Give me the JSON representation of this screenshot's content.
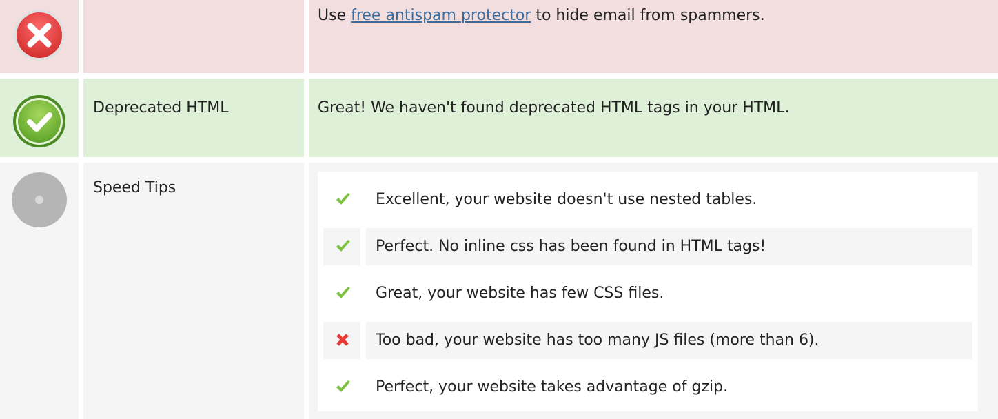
{
  "rows": {
    "email": {
      "status": "error",
      "label": "",
      "message_prefix": "Use ",
      "message_link": "free antispam protector",
      "message_suffix": " to hide email from spammers."
    },
    "deprecated": {
      "status": "ok",
      "label": "Deprecated HTML",
      "message": "Great! We haven't found deprecated HTML tags in your HTML."
    },
    "speed": {
      "status": "info",
      "label": "Speed Tips",
      "tips": [
        {
          "status": "ok",
          "text": "Excellent, your website doesn't use nested tables."
        },
        {
          "status": "ok",
          "text": "Perfect. No inline css has been found in HTML tags!"
        },
        {
          "status": "ok",
          "text": "Great, your website has few CSS files."
        },
        {
          "status": "error",
          "text": "Too bad, your website has too many JS files (more than 6)."
        },
        {
          "status": "ok",
          "text": "Perfect, your website takes advantage of gzip."
        }
      ]
    }
  },
  "colors": {
    "error_bg": "#f2dede",
    "ok_bg": "#dff0d8",
    "info_bg": "#f5f5f5",
    "error_icon": "#e53935",
    "ok_icon": "#7cc242",
    "info_icon": "#b5b5b5",
    "link": "#3b6da0"
  },
  "icons": {
    "error": "x-circle-icon",
    "ok": "check-circle-icon",
    "info": "grey-circle-icon",
    "tip_ok": "checkmark-icon",
    "tip_error": "cross-icon"
  }
}
